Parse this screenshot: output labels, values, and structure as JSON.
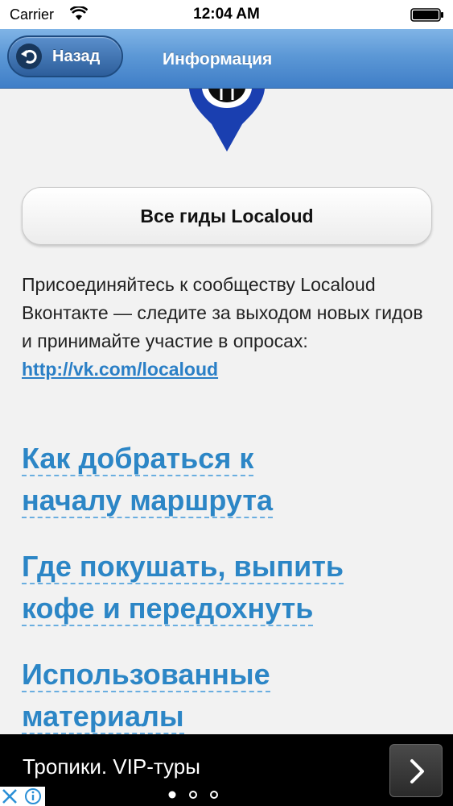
{
  "status_bar": {
    "carrier": "Carrier",
    "time": "12:04 AM"
  },
  "nav": {
    "back_label": "Назад",
    "title": "Информация"
  },
  "main_button": {
    "label": "Все гиды Localoud"
  },
  "info": {
    "text": "Присоединяйтесь к сообществу Localoud Вконтакте — следите за выходом новых гидов и принимайте участие в опросах:",
    "link": "http://vk.com/localoud"
  },
  "sections": [
    {
      "line1": "Как добраться к",
      "line2": "началу маршрута"
    },
    {
      "line1": "Где покушать, выпить",
      "line2": "кофе и передохнуть"
    },
    {
      "line1": "Использованные",
      "line2": "материалы"
    }
  ],
  "ad": {
    "text": "Тропики. VIP-туры",
    "page_dots": 3
  },
  "colors": {
    "accent": "#2c86c6",
    "nav_top": "#80b4e6",
    "nav_bottom": "#3f7ec7",
    "pin": "#1a3fb0"
  }
}
